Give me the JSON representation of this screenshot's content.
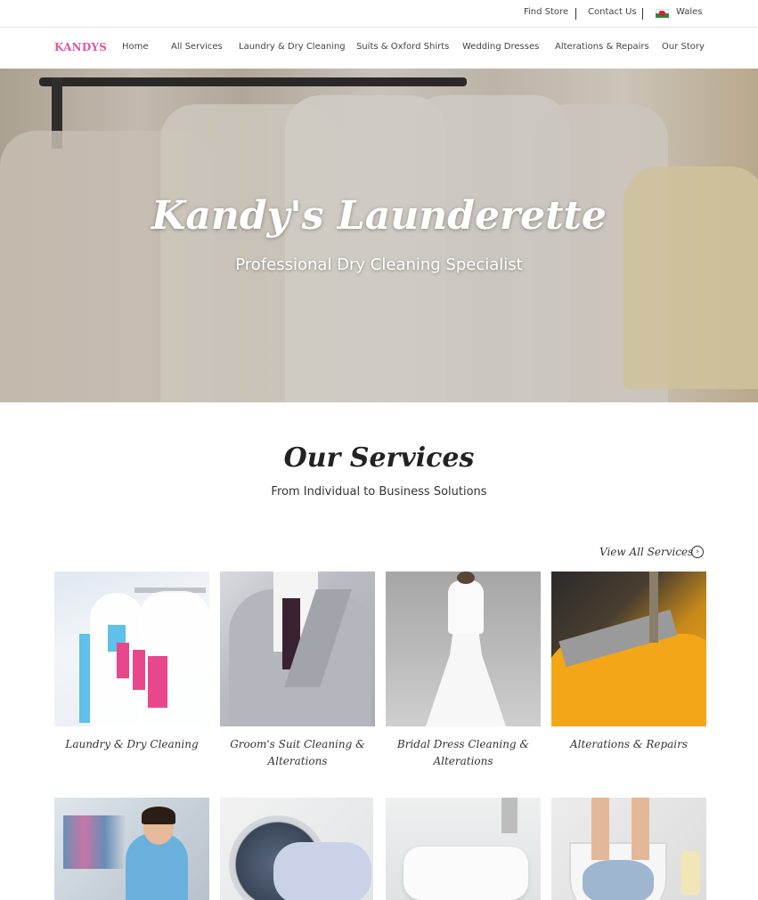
{
  "utility": {
    "find_store": "Find Store",
    "contact_us": "Contact Us",
    "region": "Wales"
  },
  "nav": {
    "logo": "KANDYS",
    "items": [
      "Home",
      "All Services",
      "Laundry & Dry Cleaning",
      "Suits & Oxford Shirts",
      "Wedding Dresses",
      "Alterations & Repairs",
      "Our Story"
    ]
  },
  "hero": {
    "title": "Kandy's Launderette",
    "subtitle": "Professional Dry Cleaning Specialist"
  },
  "services": {
    "title": "Our Services",
    "subtitle": "From Individual to Business Solutions",
    "view_all": "View All Services",
    "view_all_icon": "arrow-circle-right-icon",
    "cards": [
      {
        "label": "Laundry & Dry Cleaning"
      },
      {
        "label": "Groom's Suit Cleaning & Alterations"
      },
      {
        "label": "Bridal Dress Cleaning & Alterations"
      },
      {
        "label": "Alterations & Repairs"
      },
      {
        "label": ""
      },
      {
        "label": ""
      },
      {
        "label": ""
      },
      {
        "label": ""
      }
    ]
  },
  "colors": {
    "brand": "#e0569a",
    "text": "#333333",
    "divider": "#e3e3e3"
  }
}
